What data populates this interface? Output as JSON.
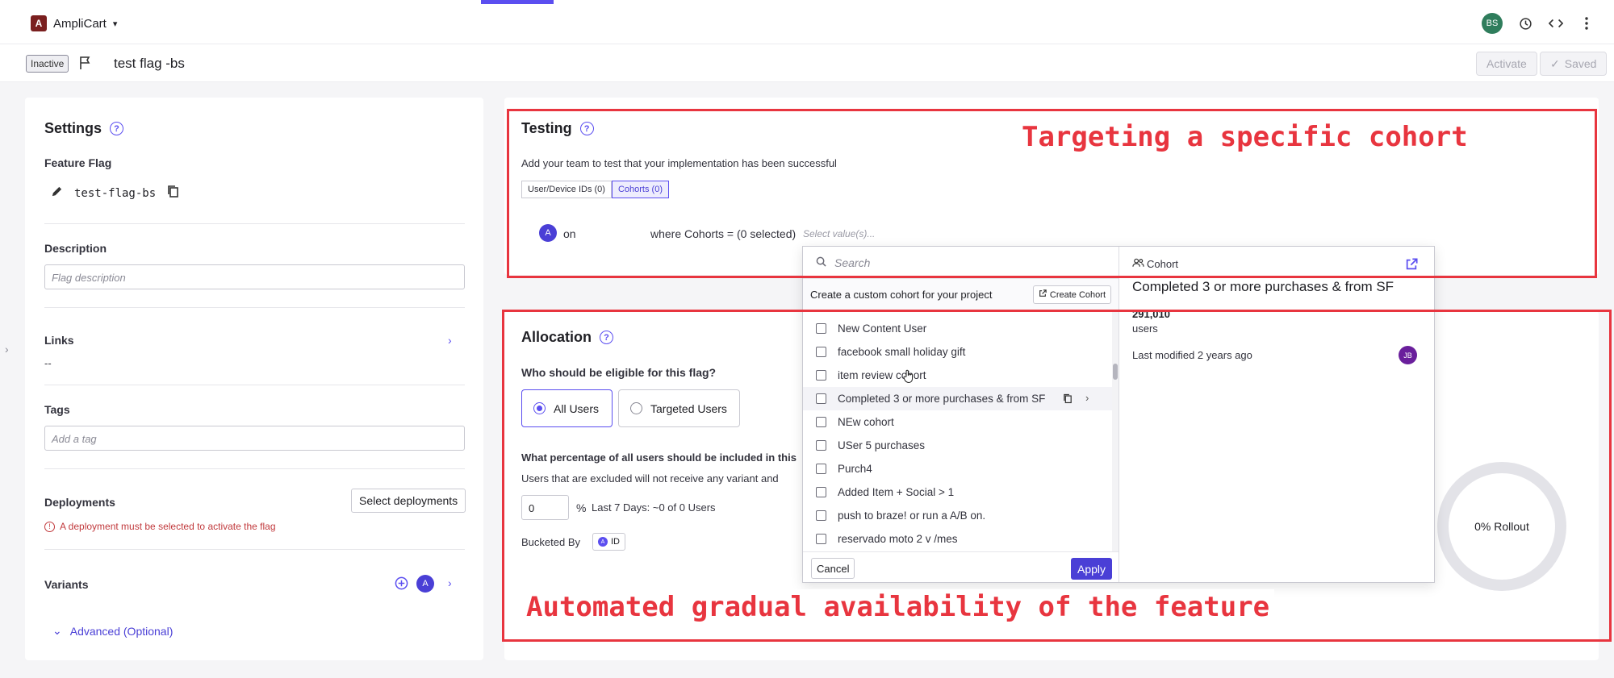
{
  "app": {
    "name": "AmpliCart",
    "logo_letter": "A",
    "user_initials": "BS"
  },
  "flag": {
    "status": "Inactive",
    "title": "test flag -bs",
    "activate_label": "Activate",
    "saved_label": "Saved"
  },
  "settings": {
    "title": "Settings",
    "feature_flag_label": "Feature Flag",
    "feature_flag_key": "test-flag-bs",
    "description_label": "Description",
    "description_placeholder": "Flag description",
    "links_label": "Links",
    "links_value": "--",
    "tags_label": "Tags",
    "tags_placeholder": "Add a tag",
    "deployments_label": "Deployments",
    "select_deployments_label": "Select deployments",
    "deployment_error": "A deployment must be selected to activate the flag",
    "variants_label": "Variants",
    "variant_badge": "A",
    "advanced_label": "Advanced (Optional)"
  },
  "testing": {
    "title": "Testing",
    "desc": "Add your team to test that your implementation has been successful",
    "tabs": [
      "User/Device IDs (0)",
      "Cohorts (0)"
    ],
    "variant_letter": "A",
    "variant_state": "on",
    "where_text": "where Cohorts = (0 selected)",
    "select_placeholder": "Select value(s)..."
  },
  "allocation": {
    "title": "Allocation",
    "eligible_question": "Who should be eligible for this flag?",
    "all_users": "All Users",
    "targeted_users": "Targeted Users",
    "pct_question": "What percentage of all users should be included in this",
    "excluded_note": "Users that are excluded will not receive any variant and",
    "pct_value": "0",
    "pct_sign": "%",
    "last7": "Last 7 Days: ~0 of 0 Users",
    "bucketed_label": "Bucketed By",
    "bucketed_value": "ID",
    "rollout_label": "0% Rollout"
  },
  "dropdown": {
    "search_placeholder": "Search",
    "create_text": "Create a custom cohort for your project",
    "create_btn": "Create Cohort",
    "items": [
      "New Content User",
      "facebook small holiday gift",
      "item review cohort",
      "Completed 3 or more purchases & from SF",
      "NEw cohort",
      "USer 5 purchases",
      "Purch4",
      "Added Item + Social > 1",
      "push to braze! or run a A/B on.",
      "reservado moto 2 v /mes"
    ],
    "cancel_label": "Cancel",
    "apply_label": "Apply",
    "preview": {
      "kind": "Cohort",
      "name": "Completed 3 or more purchases & from SF",
      "count": "291,010",
      "count_unit": "users",
      "modified": "Last modified 2 years ago",
      "owner_initials": "JB"
    }
  },
  "annotations": {
    "top": "Targeting a specific cohort",
    "bottom": "Automated gradual availability of the feature"
  },
  "colors": {
    "accent": "#5b4ef0",
    "annotation": "#e8353f",
    "error": "#c1393c"
  }
}
